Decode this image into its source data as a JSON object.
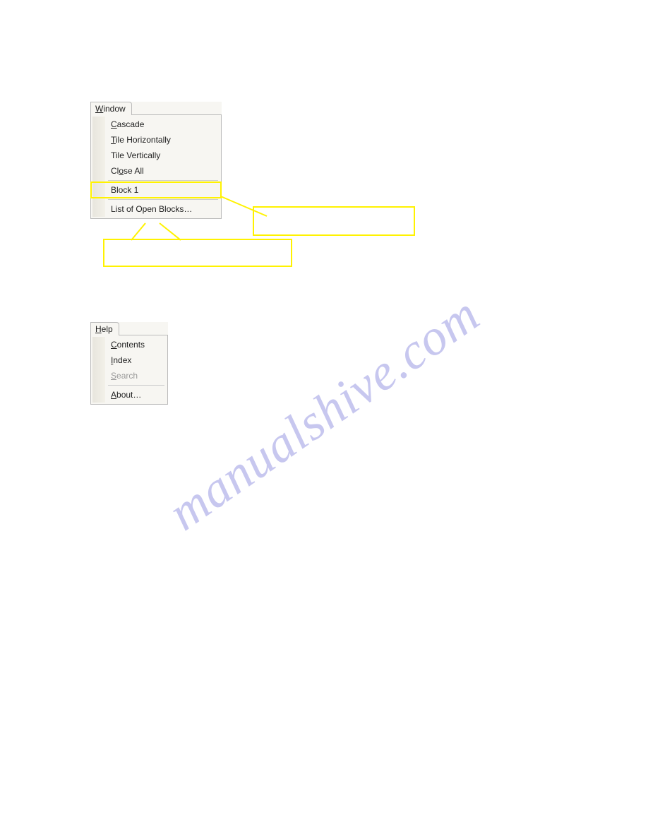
{
  "watermark": "manualshive.com",
  "window_menu": {
    "tab_label_pre": "W",
    "tab_label_rest": "indow",
    "items": {
      "cascade_pre": "C",
      "cascade_rest": "ascade",
      "tile_h_pre": "T",
      "tile_h_rest": "ile Horizontally",
      "tile_v": "Tile Vertically",
      "close_pre": "Cl",
      "close_ul": "o",
      "close_rest": "se All",
      "block1": "Block 1",
      "list_open": "List of Open Blocks…"
    }
  },
  "help_menu": {
    "tab_label_pre": "H",
    "tab_label_rest": "elp",
    "items": {
      "contents_pre": "C",
      "contents_rest": "ontents",
      "index_pre": "I",
      "index_rest": "ndex",
      "search_pre": "S",
      "search_rest": "earch",
      "about_pre": "A",
      "about_rest": "bout…"
    }
  }
}
